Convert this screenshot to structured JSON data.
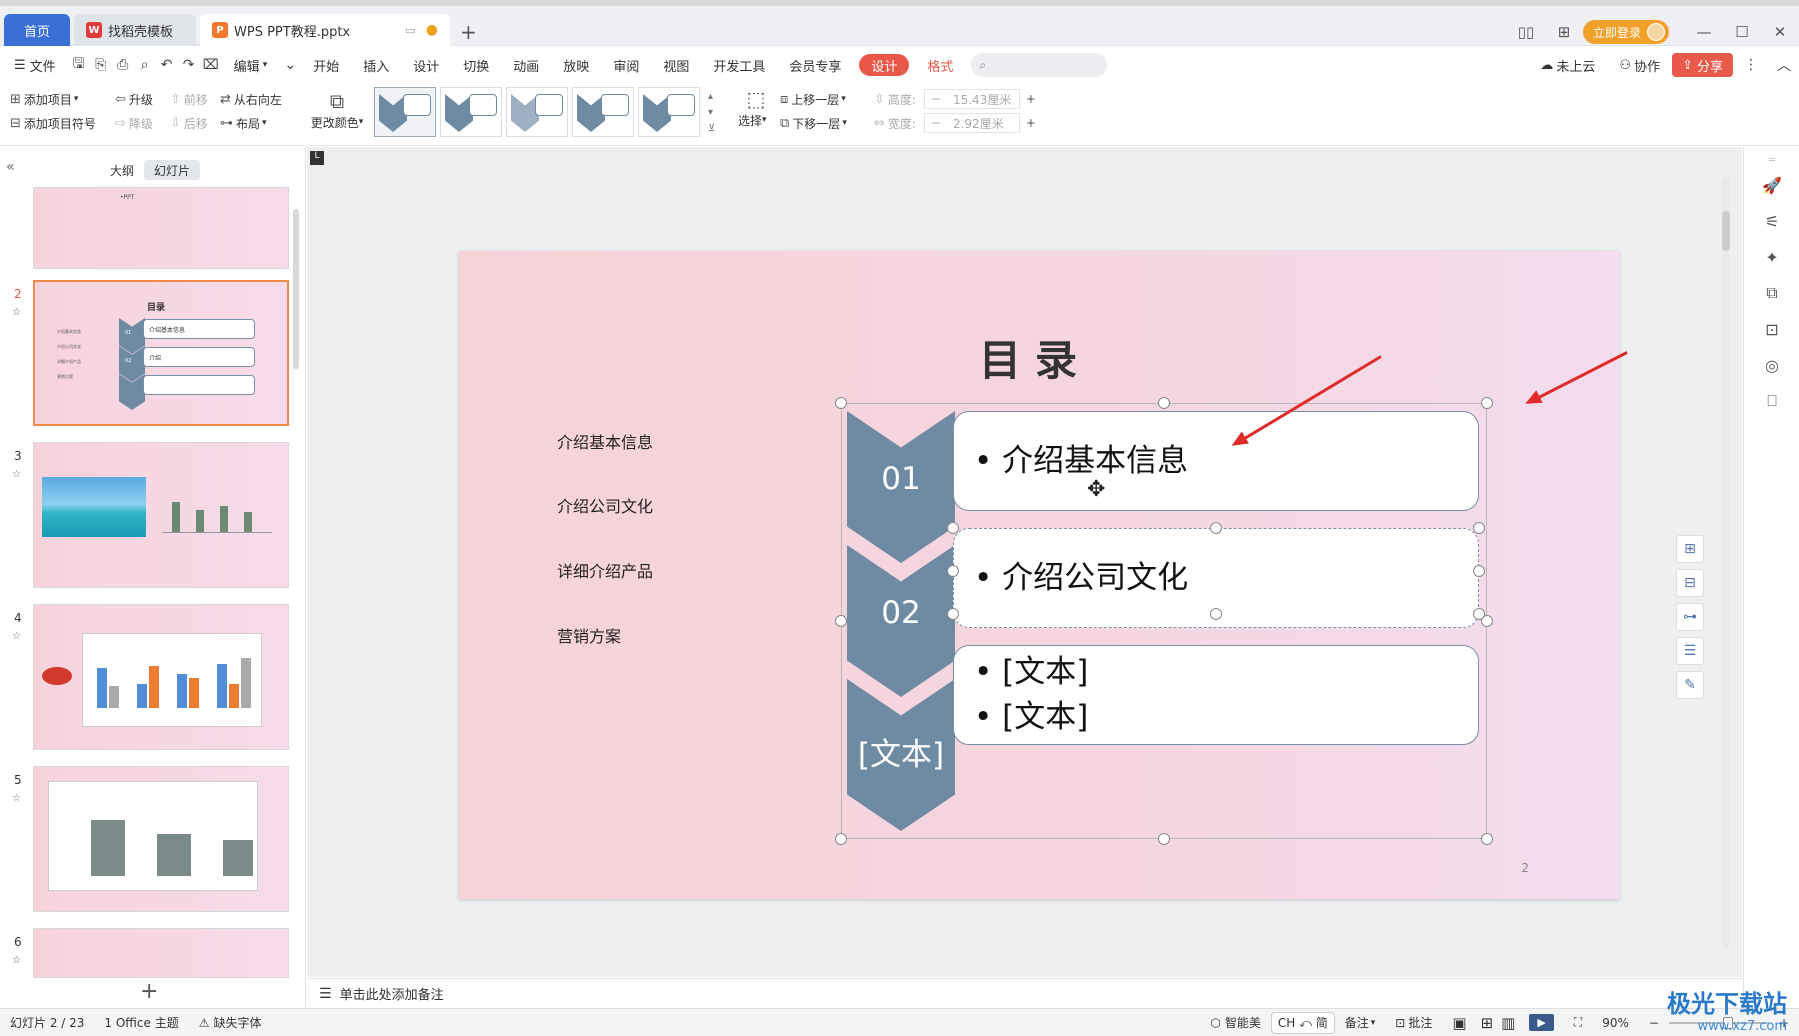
{
  "tabs": {
    "home": "首页",
    "template": "找稻壳模板",
    "document": "WPS PPT教程.pptx"
  },
  "account": {
    "login": "立即登录"
  },
  "menu": {
    "file": "文件",
    "edit": "编辑",
    "items": [
      "开始",
      "插入",
      "设计",
      "切换",
      "动画",
      "放映",
      "审阅",
      "视图",
      "开发工具",
      "会员专享"
    ],
    "design_active": "设计",
    "format": "格式",
    "cloud": "未上云",
    "collab": "协作",
    "share": "分享"
  },
  "ribbon": {
    "add_item": "添加项目",
    "add_bullet": "添加项目符号",
    "upgrade": "升级",
    "downgrade": "降级",
    "forward": "前移",
    "backward": "后移",
    "rtl": "从右向左",
    "layout": "布局",
    "change_color": "更改颜色",
    "select": "选择",
    "bring_up": "上移一层",
    "send_down": "下移一层",
    "height_label": "高度:",
    "height_value": "15.43厘米",
    "width_label": "宽度:",
    "width_value": "2.92厘米"
  },
  "left_pane": {
    "tab_outline": "大纲",
    "tab_slides": "幻灯片",
    "slide1_text": "•PPT",
    "slide2_title": "目录",
    "slide2_items": [
      "介绍基本信息",
      "介绍",
      ""
    ],
    "slide2_nums": [
      "01",
      "02"
    ],
    "slide2_left": [
      "介绍基本信息",
      "介绍公司文化",
      "详细介绍产品",
      "营销方案"
    ],
    "slide_numbers": [
      "2",
      "3",
      "4",
      "5",
      "6"
    ]
  },
  "slide": {
    "title": "目录",
    "left_items": [
      "介绍基本信息",
      "介绍公司文化",
      "详细介绍产品",
      "营销方案"
    ],
    "chevrons": [
      "01",
      "02",
      "[文本]"
    ],
    "card1": "• 介绍基本信息",
    "card2": "• 介绍公司文化",
    "card3_line1": "• [文本]",
    "card3_line2": "• [文本]",
    "page_number": "2"
  },
  "notes": {
    "placeholder": "单击此处添加备注"
  },
  "status": {
    "slide": "幻灯片 2 / 23",
    "theme": "1 Office 主题",
    "missing_font": "缺失字体",
    "smart": "智能美",
    "ime": "CH ⤺ 简",
    "notes": "备注",
    "comment": "批注",
    "zoom": "90%"
  },
  "watermark": {
    "name": "极光下载站",
    "url": "www.xz7.com"
  },
  "colors": {
    "accent": "#e8594a",
    "home_tab": "#3b6fd8",
    "chevron": "#6f8aa3",
    "selection": "#f08a48"
  }
}
